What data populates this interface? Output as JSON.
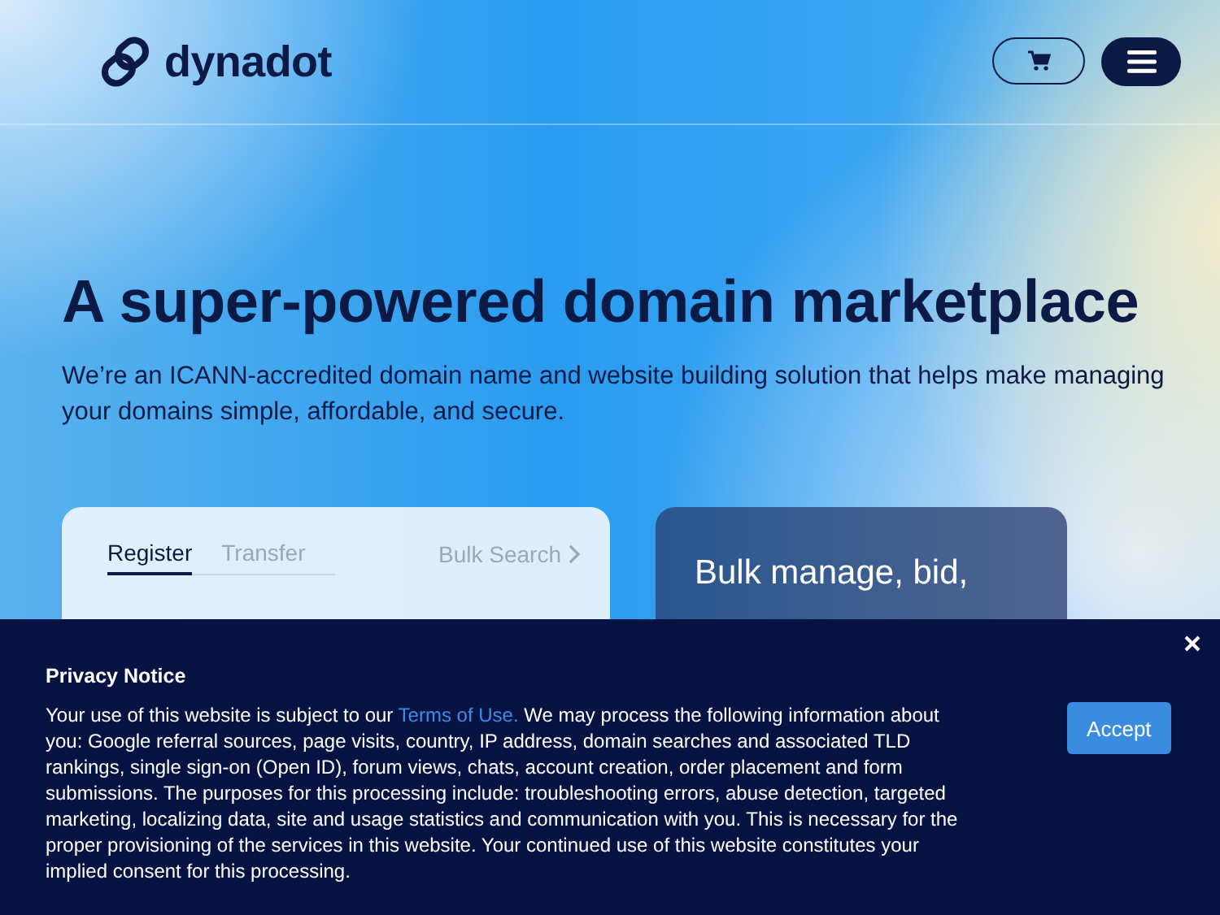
{
  "header": {
    "logo": "dynadot"
  },
  "hero": {
    "title": "A super-powered domain marketplace",
    "subtitle": "We’re an ICANN-accredited domain name and website building solution that helps make managing your domains simple, affordable, and secure."
  },
  "search_card": {
    "tabs": [
      {
        "label": "Register",
        "selected": true
      },
      {
        "label": "Transfer",
        "selected": false
      }
    ],
    "bulk_link": "Bulk Search"
  },
  "promo_card": {
    "title": "Bulk manage, bid,"
  },
  "privacy_notice": {
    "title": "Privacy Notice",
    "text_before": "Your use of this website is subject to our ",
    "link": "Terms of Use.",
    "text_after": " We may process the following information about you: Google referral sources, page visits, country, IP address, domain searches and associated TLD rankings, single sign-on (Open ID), forum views, chats, account creation, order placement and form submissions. The purposes for this processing include: troubleshooting errors, abuse detection, targeted marketing, localizing data, site and usage statistics and communication with you. This is necessary for the proper provisioning of the services in this website. Your continued use of this website constitutes your implied consent for this processing.",
    "accept": "Accept"
  }
}
